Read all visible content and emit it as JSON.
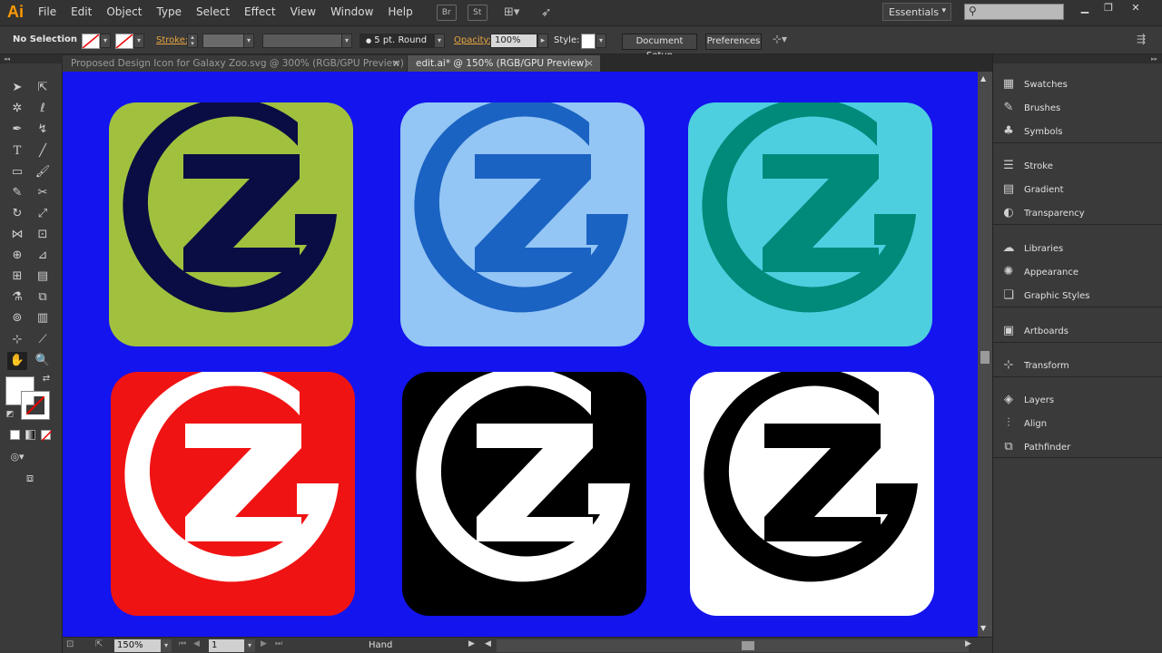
{
  "menubar": {
    "app_logo": "Ai",
    "items": [
      "File",
      "Edit",
      "Object",
      "Type",
      "Select",
      "Effect",
      "View",
      "Window",
      "Help"
    ],
    "bridge_label": "Br",
    "stock_label": "St",
    "workspace": "Essentials"
  },
  "controlbar": {
    "selection": "No Selection",
    "stroke_label": "Stroke:",
    "brush_value": "5 pt. Round",
    "opacity_label": "Opacity:",
    "opacity_value": "100%",
    "style_label": "Style:",
    "document_setup": "Document Setup",
    "preferences": "Preferences"
  },
  "tabs": [
    {
      "label": "Proposed Design Icon for Galaxy Zoo.svg @ 300% (RGB/GPU Preview)",
      "close": "×",
      "active": false
    },
    {
      "label": "edit.ai* @ 150% (RGB/GPU Preview)",
      "close": "×",
      "active": true
    }
  ],
  "canvas": {
    "background": "#1414ee",
    "icons": [
      {
        "name": "green",
        "bg": "#a1c13e",
        "fg": "#0a0d43"
      },
      {
        "name": "lightblue",
        "bg": "#93c5f5",
        "fg": "#1a63c2"
      },
      {
        "name": "cyan",
        "bg": "#4ecfe0",
        "fg": "#008a7a"
      },
      {
        "name": "red",
        "bg": "#f01313",
        "fg": "#ffffff"
      },
      {
        "name": "black",
        "bg": "#000000",
        "fg": "#ffffff"
      },
      {
        "name": "white",
        "bg": "#ffffff",
        "fg": "#000000"
      }
    ]
  },
  "statusbar": {
    "zoom": "150%",
    "artboard": "1",
    "tool": "Hand"
  },
  "panels": [
    {
      "label": "Swatches",
      "icon": "swatches-icon"
    },
    {
      "label": "Brushes",
      "icon": "brushes-icon"
    },
    {
      "label": "Symbols",
      "icon": "symbols-icon"
    },
    {
      "label": "Stroke",
      "icon": "stroke-icon"
    },
    {
      "label": "Gradient",
      "icon": "gradient-icon"
    },
    {
      "label": "Transparency",
      "icon": "transparency-icon"
    },
    {
      "label": "Libraries",
      "icon": "libraries-icon"
    },
    {
      "label": "Appearance",
      "icon": "appearance-icon"
    },
    {
      "label": "Graphic Styles",
      "icon": "graphic-styles-icon"
    },
    {
      "label": "Artboards",
      "icon": "artboards-icon"
    },
    {
      "label": "Transform",
      "icon": "transform-icon"
    },
    {
      "label": "Layers",
      "icon": "layers-icon"
    },
    {
      "label": "Align",
      "icon": "align-icon"
    },
    {
      "label": "Pathfinder",
      "icon": "pathfinder-icon"
    }
  ]
}
